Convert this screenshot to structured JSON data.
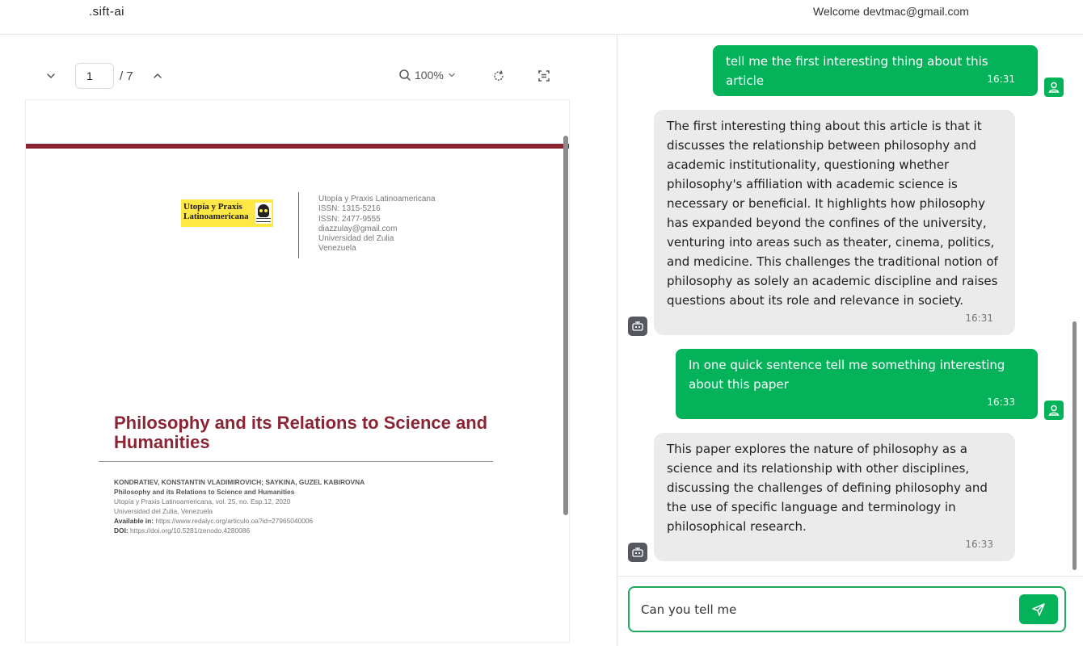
{
  "header": {
    "brand": ".sift-ai",
    "welcome": "Welcome devtmac@gmail.com"
  },
  "pdf_viewer": {
    "page_current": "1",
    "page_total": "/ 7",
    "zoom": "100%",
    "icons": {
      "prev_page": "chevron-down-icon",
      "next_page": "chevron-up-icon",
      "zoom": "search-icon",
      "zoom_menu": "chevron-down-icon",
      "rotate": "rotate-icon",
      "fit": "fit-page-icon"
    },
    "document": {
      "logo_line1": "Utopía y Praxis",
      "logo_line2": "Latinoamericana",
      "journal_lines": [
        "Utopía y Praxis Latinoamericana",
        "ISSN: 1315-5216",
        "ISSN: 2477-9555",
        "diazzulay@gmail.com",
        "Universidad del Zulia",
        "Venezuela"
      ],
      "title": "Philosophy and its Relations to Science and Humanities",
      "authors": "KONDRATIEV, KONSTANTIN VLADIMIROVICH; SAYKINA, GUZEL KABIROVNA",
      "cite_title": "Philosophy and its Relations to Science and Humanities",
      "cite_journal": "Utopía y Praxis Latinoamericana, vol. 25, no. Esp.12, 2020",
      "cite_university": "Universidad del Zulia, Venezuela",
      "available_label": "Available in:",
      "available_url": "https://www.redalyc.org/articulo.oa?id=27965040006",
      "doi_label": "DOI:",
      "doi_url": "https://doi.org/10.5281/zenodo.4280086"
    }
  },
  "chat": {
    "messages": [
      {
        "role": "user",
        "text": "tell me the first interesting thing about this article",
        "time": "16:31"
      },
      {
        "role": "assistant",
        "text": "The first interesting thing about this article is that it discusses the relationship between philosophy and academic institutionality, questioning whether philosophy's affiliation with academic science is necessary or beneficial. It highlights how philosophy has expanded beyond the confines of the university, venturing into areas such as theater, cinema, politics, and medicine. This challenges the traditional notion of philosophy as solely an academic discipline and raises questions about its role and relevance in society.",
        "time": "16:31"
      },
      {
        "role": "user",
        "text": "In one quick sentence tell me something interesting about this paper",
        "time": "16:33"
      },
      {
        "role": "assistant",
        "text": "This paper explores the nature of philosophy as a science and its relationship with other disciplines, discussing the challenges of defining philosophy and the use of specific language and terminology in philosophical research.",
        "time": "16:33"
      }
    ],
    "composer": {
      "value": "Can you tell me",
      "send_icon": "send-icon"
    },
    "avatar_icons": {
      "user": "user-icon",
      "assistant": "bot-icon"
    },
    "colors": {
      "accent": "#04b25a",
      "bot_bubble": "#ebebeb",
      "title_red": "#8b2534"
    }
  }
}
